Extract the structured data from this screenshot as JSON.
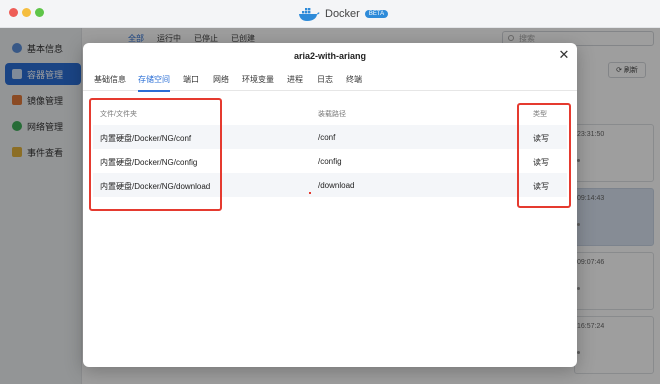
{
  "window": {
    "app_name": "Docker",
    "badge": "BETA",
    "brand_color": "#2b6fd6"
  },
  "sidebar": {
    "items": [
      {
        "label": "基本信息",
        "icon": "info-icon",
        "active": false
      },
      {
        "label": "容器管理",
        "icon": "container-icon",
        "active": true
      },
      {
        "label": "镜像管理",
        "icon": "image-icon",
        "active": false
      },
      {
        "label": "网络管理",
        "icon": "network-icon",
        "active": false
      },
      {
        "label": "事件查看",
        "icon": "event-icon",
        "active": false
      }
    ]
  },
  "main": {
    "status_tabs": [
      "全部",
      "运行中",
      "已停止",
      "已创建"
    ],
    "search_placeholder": "搜索",
    "refresh_label": "刷新",
    "card_times": [
      "23:31:50",
      "09:14:43",
      "09:07:46",
      "16:57:24"
    ]
  },
  "dialog": {
    "title": "aria2-with-ariang",
    "tabs": [
      "基础信息",
      "存储空间",
      "端口",
      "网络",
      "环境变量",
      "进程",
      "日志",
      "终端"
    ],
    "active_tab": "存储空间",
    "table": {
      "headers": [
        "文件/文件夹",
        "装载路径",
        "类型"
      ],
      "rows": [
        {
          "source": "内置硬盘/Docker/NG/conf",
          "mount": "/conf",
          "type": "读写"
        },
        {
          "source": "内置硬盘/Docker/NG/config",
          "mount": "/config",
          "type": "读写"
        },
        {
          "source": "内置硬盘/Docker/NG/download",
          "mount": "/download",
          "type": "读写"
        }
      ]
    },
    "highlight_color": "#e53a2f"
  }
}
